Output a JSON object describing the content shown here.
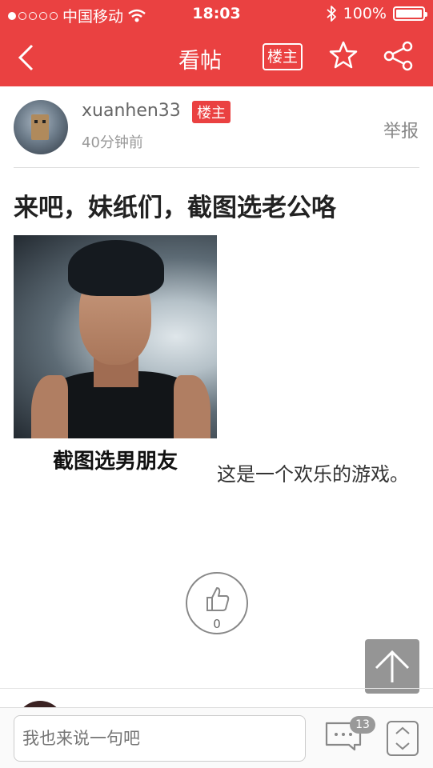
{
  "status_bar": {
    "carrier": "中国移动",
    "time": "18:03",
    "battery": "100%"
  },
  "nav": {
    "title": "看帖",
    "louzhu_button": "楼主",
    "icons": [
      "back-icon",
      "star-icon",
      "share-icon"
    ]
  },
  "author": {
    "username": "xuanhen33",
    "badge": "楼主",
    "post_time": "40分钟前",
    "report_label": "举报"
  },
  "post": {
    "title": "来吧，妹纸们，截图选老公咯",
    "image_caption": "截图选男朋友",
    "body_text": "这是一个欢乐的游戏。"
  },
  "like": {
    "count": "0"
  },
  "bottom_bar": {
    "input_placeholder": "我也来说一句吧",
    "comment_count": "13"
  },
  "colors": {
    "accent": "#ea4141",
    "badge_gray": "#999999"
  }
}
